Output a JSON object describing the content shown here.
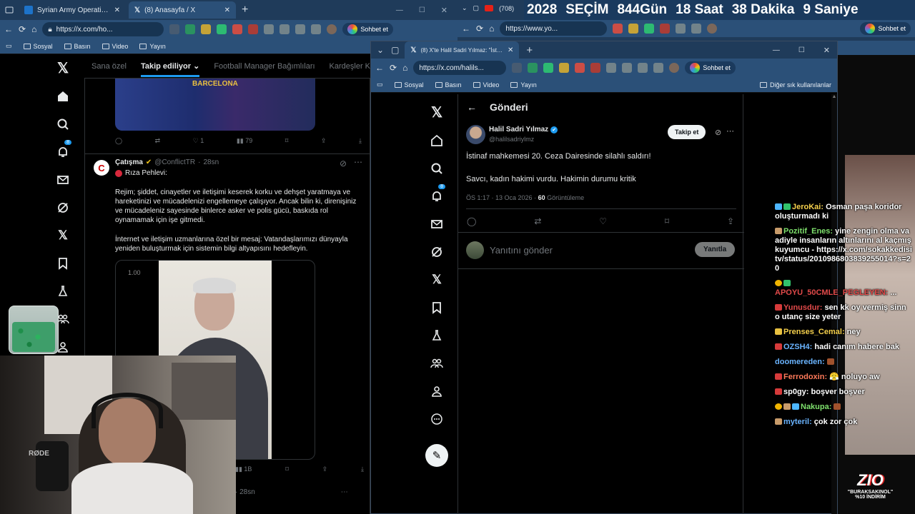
{
  "left_browser": {
    "tabs": [
      {
        "label": "Syrian Army Operations Command"
      },
      {
        "label": "(8) Anasayfa / X"
      }
    ],
    "url": "https://x.com/ho...",
    "bookmarks": [
      "Sosyal",
      "Basın",
      "Video",
      "Yayın"
    ],
    "chat_button": "Sohbet et"
  },
  "feed": {
    "tabs": [
      "Sana özel",
      "Takip ediliyor",
      "Football Manager Bağımlıları",
      "Kardeşler Kıra"
    ],
    "prev_tweet_actions": {
      "likes": "1",
      "views": "79"
    },
    "image_text": "BARCELONA",
    "tweet": {
      "author": "Çatışma",
      "handle": "@ConflictTR",
      "time": "28sn",
      "title_line": "Rıza Pehlevi:",
      "p1": "Rejim; şiddet, cinayetler ve iletişimi keserek korku ve dehşet yaratmaya ve hareketinizi ve mücadelenizi engellemeye çalışıyor. Ancak bilin ki, direnişiniz ve mücadeleniz sayesinde binlerce asker ve polis gücü, baskıda rol oynamamak için işe gitmedi.",
      "p2": "İnternet ve iletişim uzmanlarına özel bir mesaj: Vatandaşlarımızı dünyayla yeniden buluşturmak için sistemin bilgi altyapısını hedefleyin.",
      "video_speed": "1.00",
      "views": "1B"
    },
    "next_time": "28sn",
    "notification_count": "8"
  },
  "right_browser": {
    "tab_label": "(8) X'te Halil Sadri Yılmaz: \"İstinaf ...",
    "url": "https://x.com/halils...",
    "bookmarks": [
      "Sosyal",
      "Basın",
      "Video",
      "Yayın"
    ],
    "other_bookmarks": "Diğer sık kullanılanlar",
    "chat_button": "Sohbet et",
    "top_tab_count": "(708)",
    "top_url": "https://www.yo..."
  },
  "post": {
    "header": "Gönderi",
    "name": "Halil Sadri Yılmaz",
    "handle": "@halilsadriylmz",
    "follow": "Takip et",
    "line1": "İstinaf mahkemesi 20. Ceza Dairesinde silahlı saldırı!",
    "line2": "Savcı, kadın hakimi vurdu. Hakimin durumu kritik",
    "meta_time": "ÖS 1:17 · 13 Oca 2026 · ",
    "views_count": "60",
    "views_label": " Görüntüleme",
    "reply_placeholder": "Yanıtını gönder",
    "reply_button": "Yanıtla",
    "notification_count": "8"
  },
  "countdown": {
    "year": "2028",
    "label": "SEÇİM",
    "days": "844",
    "days_label": "Gün",
    "hours": "18",
    "hours_label": "Saat",
    "minutes": "38",
    "minutes_label": "Dakika",
    "seconds": "9",
    "seconds_label": "Saniye"
  },
  "chat": [
    {
      "user": "JeroKai:",
      "msg": " Osman paşa koridor oluşturmadı ki",
      "color": "#f5d04c"
    },
    {
      "user": "Pozitif_Enes:",
      "msg": " yine zengin olma vaadiyle insanların altınlarını al kaçmış kuyumcu - https://x.com/sokakkedisitv/status/2010986803839255014?s=20",
      "color": "#7ee06c"
    },
    {
      "user": "APOYU_50CMLE_PEGLEYEN:",
      "msg": " ...",
      "color": "#e24a4a"
    },
    {
      "user": "Yunusdur:",
      "msg": " sen kk oy vermiş sinn o utanç size yeter",
      "color": "#e24a4a"
    },
    {
      "user": "Prenses_Cemal:",
      "msg": " ney",
      "color": "#f5d04c"
    },
    {
      "user": "OZSH4:",
      "msg": " hadi canım habere bak",
      "color": "#6ab4ff"
    },
    {
      "user": "doomereden:",
      "msg": "",
      "color": "#6ab4ff"
    },
    {
      "user": "Ferrodoxin:",
      "msg": " 😤 noluyo aw",
      "color": "#ff7a5a"
    },
    {
      "user": "sp0gy:",
      "msg": " boşver boşver",
      "color": "#ffffff"
    },
    {
      "user": "Nakupa:",
      "msg": "",
      "color": "#7ee06c"
    },
    {
      "user": "myteril:",
      "msg": " çok zor çok",
      "color": "#6ab4ff"
    }
  ],
  "promo": {
    "logo": "ZIO",
    "line1": "\"BURAKSAKINOL\"",
    "line2": "%10 İNDİRİM"
  },
  "icons": [
    "x-logo-icon",
    "home-icon",
    "search-icon",
    "bell-icon",
    "mail-icon",
    "grok-icon",
    "bookmark-icon",
    "flask-icon",
    "people-icon",
    "person-icon",
    "more-icon",
    "post-icon",
    "reply-icon",
    "retweet-icon",
    "like-icon",
    "share-icon",
    "download-icon",
    "back-arrow-icon",
    "verified-icon"
  ]
}
